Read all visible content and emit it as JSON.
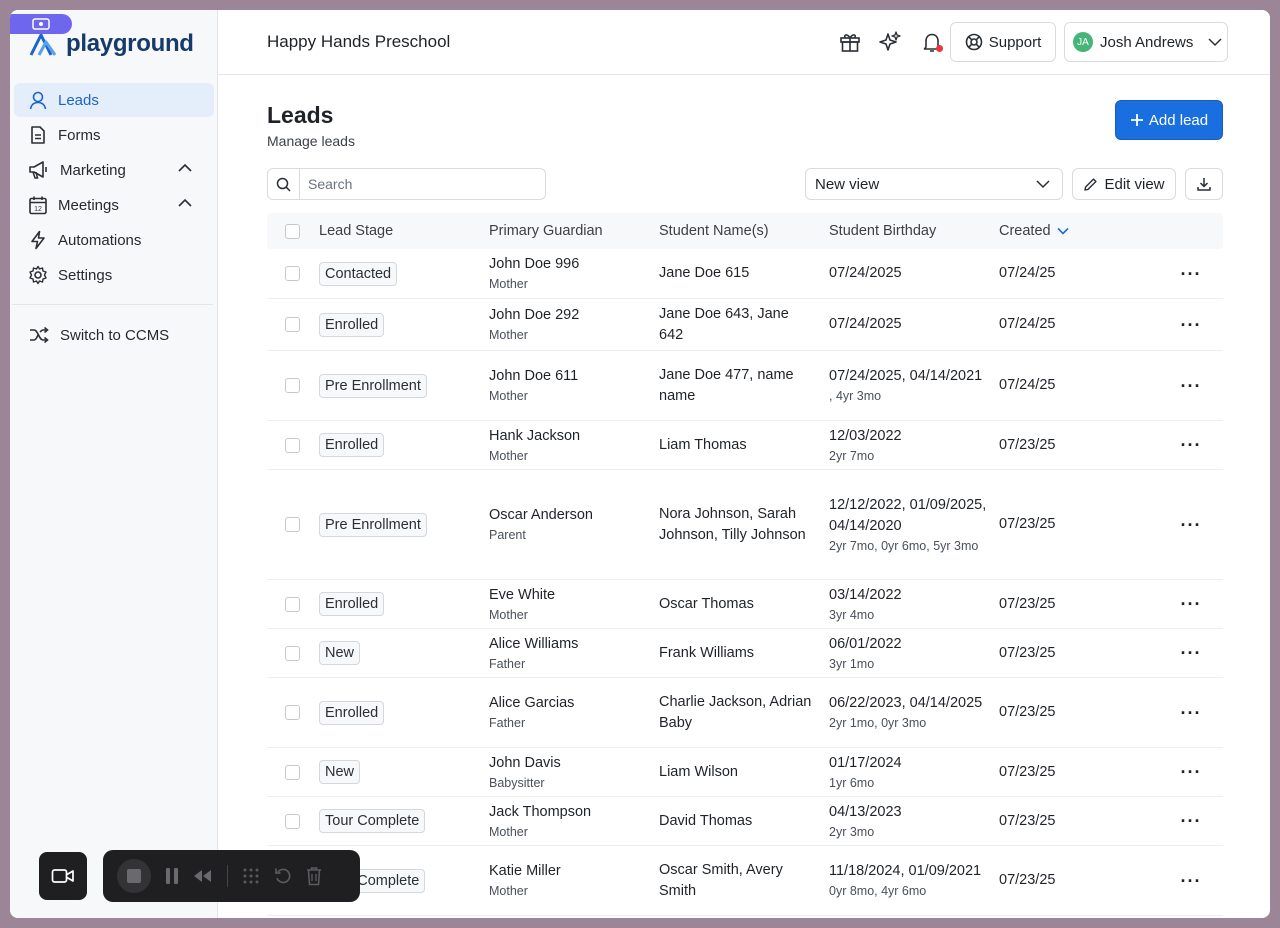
{
  "app": {
    "logo_text": "playground",
    "school_name": "Happy Hands Preschool"
  },
  "sidebar": {
    "items": [
      {
        "label": "Leads",
        "icon": "user-icon",
        "active": true
      },
      {
        "label": "Forms",
        "icon": "document-icon"
      },
      {
        "label": "Marketing",
        "icon": "megaphone-icon",
        "expandable": true
      },
      {
        "label": "Meetings",
        "icon": "calendar-icon",
        "expandable": true,
        "icon_text": "12"
      },
      {
        "label": "Automations",
        "icon": "lightning-icon"
      },
      {
        "label": "Settings",
        "icon": "gear-icon"
      }
    ],
    "switch_label": "Switch to CCMS"
  },
  "header": {
    "support_label": "Support",
    "user": {
      "initials": "JA",
      "name": "Josh Andrews"
    },
    "accent": "#1a6fe0",
    "notification_dot_color": "#e5383b"
  },
  "page": {
    "title": "Leads",
    "subtitle": "Manage leads",
    "add_label": "Add lead",
    "search_placeholder": "Search",
    "view_selected": "New view",
    "edit_view_label": "Edit view"
  },
  "table": {
    "columns": [
      "Lead Stage",
      "Primary Guardian",
      "Student Name(s)",
      "Student Birthday",
      "Created"
    ],
    "rows": [
      {
        "stage": "Contacted",
        "guardian": "John Doe 996",
        "relation": "Mother",
        "students": "Jane Doe 615",
        "birthday": "07/24/2025",
        "age": "",
        "created": "07/24/25"
      },
      {
        "stage": "Enrolled",
        "guardian": "John Doe 292",
        "relation": "Mother",
        "students": "Jane Doe 643, Jane 642",
        "birthday": "07/24/2025",
        "age": "",
        "created": "07/24/25"
      },
      {
        "stage": "Pre Enrollment",
        "guardian": "John Doe 611",
        "relation": "Mother",
        "students": "Jane Doe 477, name name",
        "birthday": "07/24/2025, 04/14/2021",
        "age": ", 4yr 3mo",
        "created": "07/24/25"
      },
      {
        "stage": "Enrolled",
        "guardian": "Hank Jackson",
        "relation": "Mother",
        "students": "Liam Thomas",
        "birthday": "12/03/2022",
        "age": "2yr 7mo",
        "created": "07/23/25"
      },
      {
        "stage": "Pre Enrollment",
        "guardian": "Oscar Anderson",
        "relation": "Parent",
        "students": "Nora Johnson, Sarah Johnson, Tilly Johnson",
        "birthday": "12/12/2022, 01/09/2025, 04/14/2020",
        "age": "2yr 7mo, 0yr 6mo, 5yr 3mo",
        "created": "07/23/25"
      },
      {
        "stage": "Enrolled",
        "guardian": "Eve White",
        "relation": "Mother",
        "students": "Oscar Thomas",
        "birthday": "03/14/2022",
        "age": "3yr 4mo",
        "created": "07/23/25"
      },
      {
        "stage": "New",
        "guardian": "Alice Williams",
        "relation": "Father",
        "students": "Frank Williams",
        "birthday": "06/01/2022",
        "age": "3yr 1mo",
        "created": "07/23/25"
      },
      {
        "stage": "Enrolled",
        "guardian": "Alice Garcias",
        "relation": "Father",
        "students": "Charlie Jackson, Adrian Baby",
        "birthday": "06/22/2023, 04/14/2025",
        "age": "2yr 1mo, 0yr 3mo",
        "created": "07/23/25"
      },
      {
        "stage": "New",
        "guardian": "John Davis",
        "relation": "Babysitter",
        "students": "Liam Wilson",
        "birthday": "01/17/2024",
        "age": "1yr 6mo",
        "created": "07/23/25"
      },
      {
        "stage": "Tour Complete",
        "guardian": "Jack Thompson",
        "relation": "Mother",
        "students": "David Thomas",
        "birthday": "04/13/2023",
        "age": "2yr 3mo",
        "created": "07/23/25"
      },
      {
        "stage": "Tour Complete",
        "guardian": "Katie Miller",
        "relation": "Mother",
        "students": "Oscar Smith, Avery Smith",
        "birthday": "11/18/2024, 01/09/2021",
        "age": "0yr 8mo, 4yr 6mo",
        "created": "07/23/25"
      }
    ]
  }
}
